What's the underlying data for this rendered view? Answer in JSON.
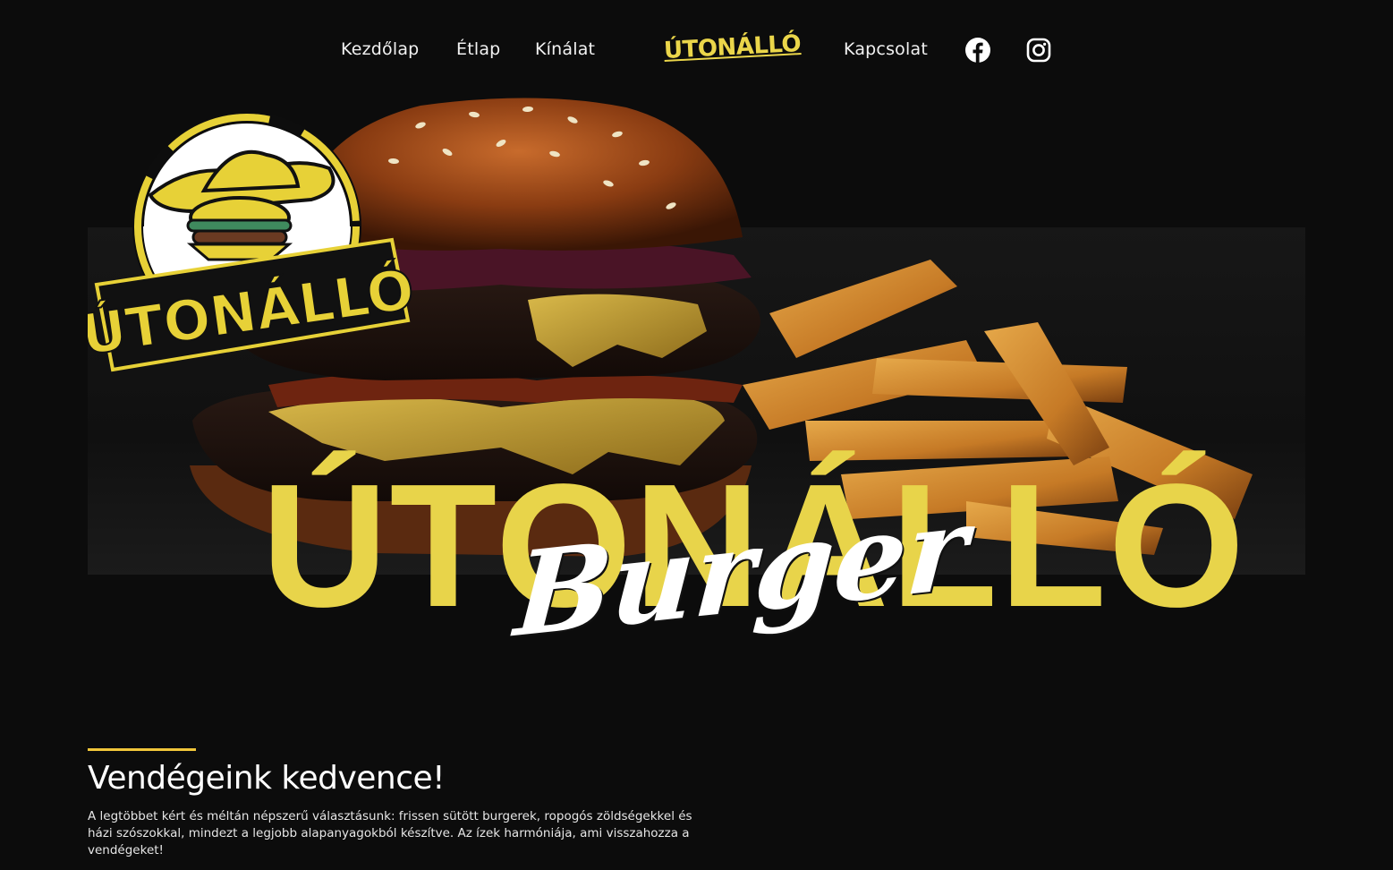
{
  "nav": {
    "links": [
      "Kezdőlap",
      "Étlap",
      "Kínálat",
      "Kapcsolat"
    ],
    "logo_text": "ÚTONÁLLÓ",
    "social": [
      {
        "name": "facebook-icon"
      },
      {
        "name": "instagram-icon"
      }
    ]
  },
  "hero": {
    "badge_text": "ÚTONÁLLÓ",
    "title": "ÚTONÁLLÓ",
    "script": "Burger"
  },
  "favorites": {
    "title": "Vendégeink kedvence!",
    "text": "A legtöbbet kért és méltán népszerű választásunk: frissen sütött burgerek, ropogós zöldségekkel és házi szószokkal, mindezt a legjobb alapanyagokból készítve. Az ízek harmóniája, ami visszahozza a vendégeket!"
  },
  "colors": {
    "background": "#0c0c0c",
    "accent_yellow": "#e8d44a",
    "line_yellow": "#f1c63a"
  }
}
